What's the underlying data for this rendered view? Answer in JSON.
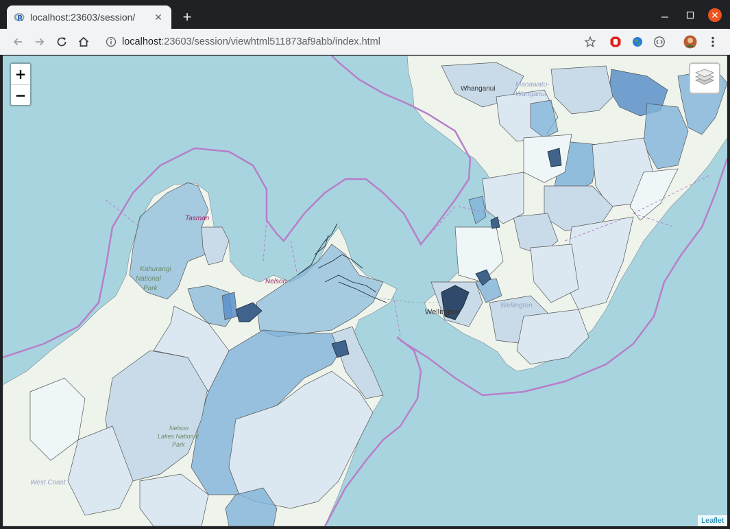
{
  "browser": {
    "tab_title": "localhost:23603/session/​",
    "url_host": "localhost",
    "url_rest": ":23603/session/viewhtml511873af9abb/index.html",
    "favicon": "r-logo-icon"
  },
  "map": {
    "zoom_in": "+",
    "zoom_out": "−",
    "attribution": "Leaflet",
    "labels": {
      "tasman": "Tasman",
      "nelson": "Nelson",
      "whanganui": "Whanganui",
      "manawatu": "Manawatu-",
      "wanganui": "Wanganui",
      "wellington_city": "Wellington",
      "wellington_region": "Wellington",
      "kahurangi": "Kahurangi",
      "national": "National",
      "park": "Park",
      "nelson_lakes": "Nelson",
      "lakes_national": "Lakes National",
      "park2": "Park",
      "west_coast": "West Coast"
    },
    "colors": {
      "sea": "#a8d4df",
      "land": "#eef4ec",
      "boundary": "#b77fc9",
      "choropleth_light": "#eef6f8",
      "choropleth_mid": "#c9dbe9",
      "choropleth_strong": "#7fb3d9",
      "choropleth_dark": "#5b8fc9"
    }
  }
}
